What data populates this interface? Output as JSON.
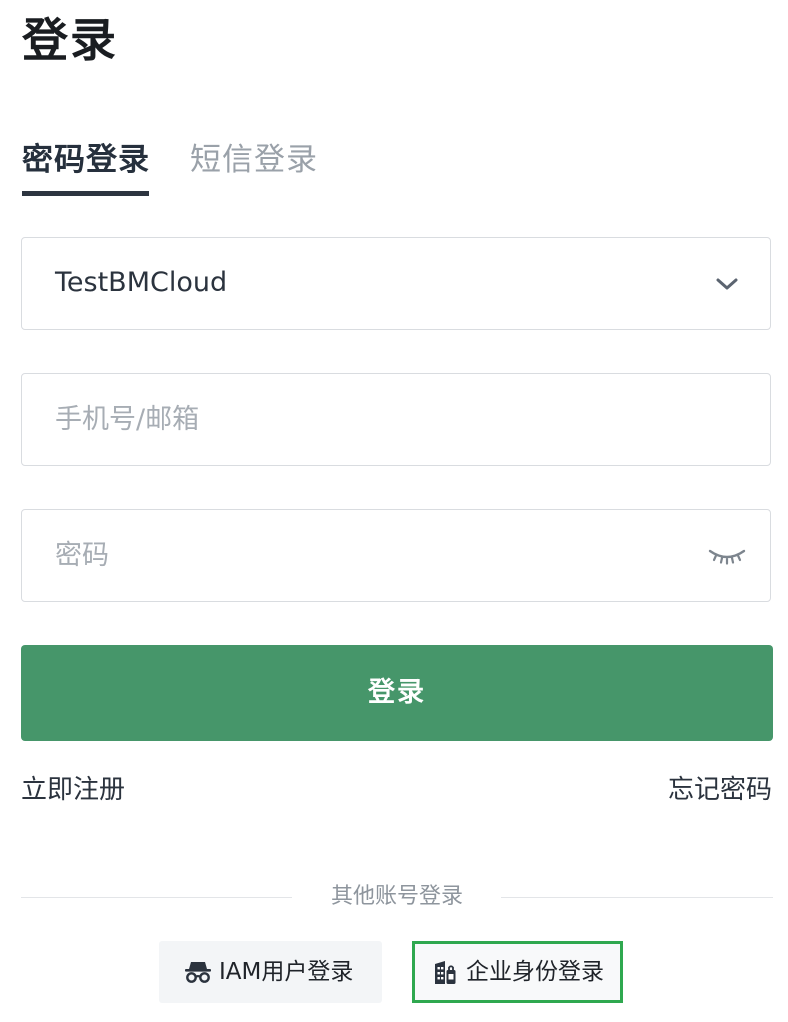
{
  "page": {
    "title": "登录"
  },
  "tabs": {
    "password_login": "密码登录",
    "sms_login": "短信登录"
  },
  "form": {
    "account_select": {
      "value": "TestBMCloud"
    },
    "account_input": {
      "placeholder": "手机号/邮箱",
      "value": ""
    },
    "password_input": {
      "placeholder": "密码",
      "value": ""
    },
    "submit_label": "登录"
  },
  "links": {
    "register": "立即注册",
    "forgot_password": "忘记密码"
  },
  "other_login": {
    "divider_label": "其他账号登录",
    "iam_label": "IAM用户登录",
    "sso_label": "企业身份登录"
  },
  "icons": {
    "select_arrow": "chevron-down-icon",
    "password_visibility": "eye-closed-icon",
    "iam": "incognito-icon",
    "sso": "enterprise-icon"
  },
  "colors": {
    "primary_button": "#46966a",
    "tab_underline": "#2d3540",
    "selected_highlight": "#2fa84f"
  }
}
